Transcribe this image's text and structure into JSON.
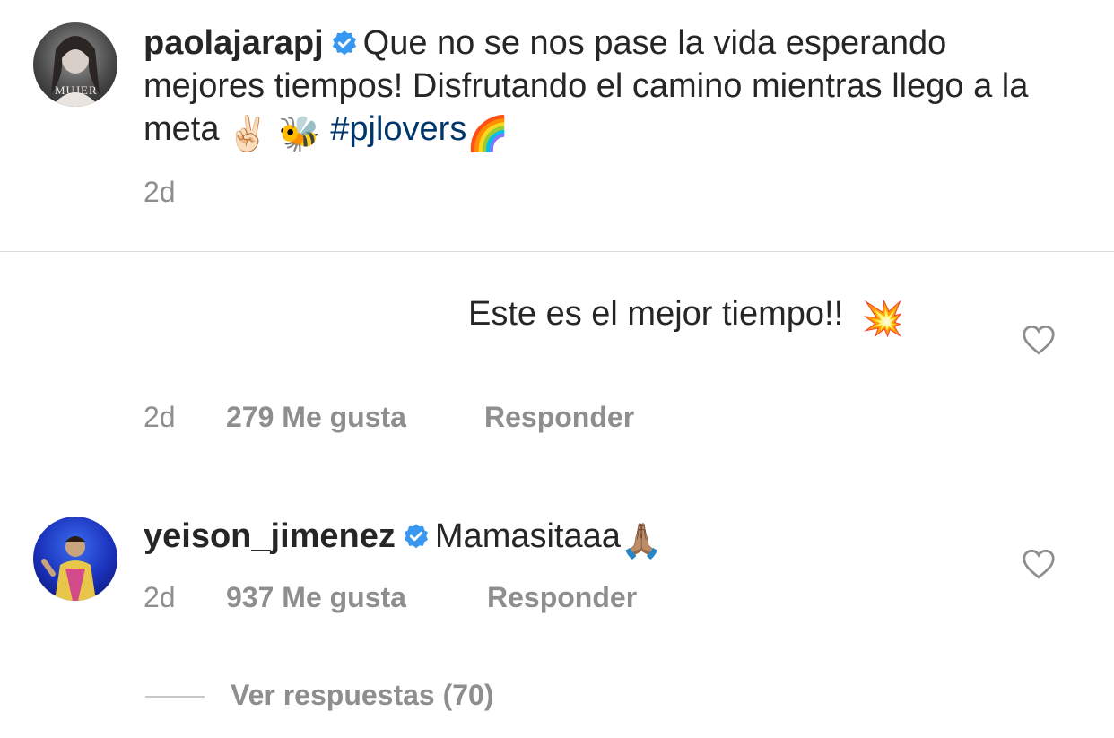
{
  "caption": {
    "username": "paolajarapj",
    "text": "Que no se nos pase la vida esperando mejores tiempos! Disfrutando el camino mientras llego a la meta",
    "emoji_1": "✌🏻",
    "emoji_2": "🐝",
    "hashtag": "#pjlovers",
    "emoji_3": "🌈",
    "time": "2d",
    "avatar_watermark": "MUJER"
  },
  "comments": [
    {
      "text": "Este es el mejor tiempo!!",
      "emoji": "💥",
      "time": "2d",
      "likes": "279 Me gusta",
      "reply": "Responder"
    },
    {
      "username": "yeison_jimenez",
      "text": "Mamasitaaa",
      "emoji": "🙏🏽",
      "time": "2d",
      "likes": "937 Me gusta",
      "reply": "Responder"
    }
  ],
  "view_replies": "Ver respuestas (70)",
  "colors": {
    "verified": "#3897f0",
    "hashtag": "#00376b",
    "meta": "#8e8e8e"
  }
}
